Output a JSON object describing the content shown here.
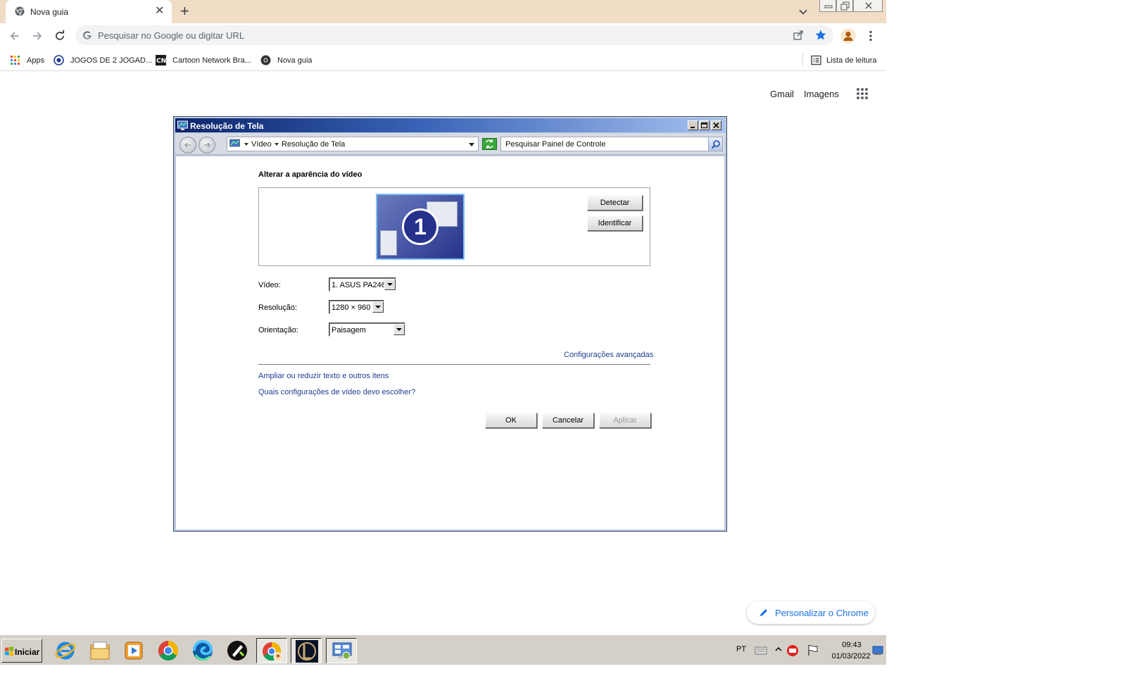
{
  "browser": {
    "tab_title": "Nova guia",
    "omnibox_placeholder": "Pesquisar no Google ou digitar URL",
    "bookmarks": [
      {
        "label": "Apps",
        "icon": "apps-grid-icon"
      },
      {
        "label": "JOGOS DE 2 JOGAD...",
        "icon": "globe-icon"
      },
      {
        "label": "Cartoon Network Bra...",
        "icon": "cartoon-network-icon"
      },
      {
        "label": "Nova guia",
        "icon": "chrome-icon"
      }
    ],
    "reading_list_label": "Lista de leitura"
  },
  "google": {
    "gmail_label": "Gmail",
    "images_label": "Imagens",
    "customize_label": "Personalizar o Chrome"
  },
  "dialog": {
    "title": "Resolução de Tela",
    "breadcrumb": [
      "Vídeo",
      "Resolução de Tela"
    ],
    "search_placeholder": "Pesquisar Painel de Controle",
    "heading": "Alterar a aparência do vídeo",
    "monitor_number": "1",
    "detect_label": "Detectar",
    "identify_label": "Identificar",
    "fields": {
      "video_label": "Vídeo:",
      "video_value": "1. ASUS PA246",
      "resolution_label": "Resolução:",
      "resolution_value": "1280 × 960",
      "orientation_label": "Orientação:",
      "orientation_value": "Paisagem"
    },
    "advanced_link": "Configurações avançadas",
    "links": [
      "Ampliar ou reduzir texto e outros itens",
      "Quais configurações de vídeo devo escolher?"
    ],
    "ok_label": "OK",
    "cancel_label": "Cancelar",
    "apply_label": "Aplicar"
  },
  "taskbar": {
    "start_label": "Iniciar",
    "language": "PT",
    "time": "09:43",
    "date": "01/03/2022",
    "apps": [
      "internet-explorer-icon",
      "file-explorer-icon",
      "media-player-icon",
      "chrome-icon",
      "edge-icon",
      "game-app-icon",
      "chrome-profile-icon",
      "league-of-legends-icon",
      "control-panel-icon"
    ]
  },
  "colors": {
    "tabstrip": "#f1dcc6",
    "dialog_title_start": "#0b246a",
    "link": "#1c3d8f",
    "chrome_blue": "#1a73e8"
  }
}
